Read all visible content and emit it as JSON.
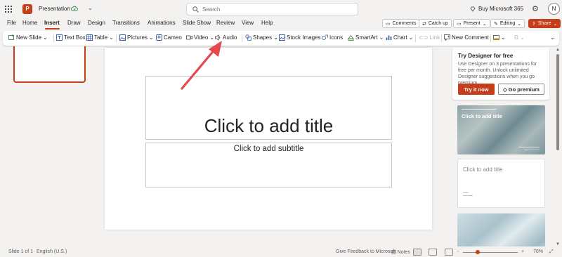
{
  "titlebar": {
    "app_logo": "P",
    "doc_title": "Presentation",
    "search_placeholder": "Search",
    "buy_label": "Buy Microsoft 365",
    "avatar_initial": "N"
  },
  "menu": {
    "tabs": [
      "File",
      "Home",
      "Insert",
      "Draw",
      "Design",
      "Transitions",
      "Animations",
      "Slide Show",
      "Review",
      "View",
      "Help"
    ],
    "active_tab": "Insert",
    "comments_label": "Comments",
    "catchup_label": "Catch up",
    "present_label": "Present",
    "editing_label": "Editing",
    "share_label": "Share"
  },
  "ribbon": {
    "new_slide": "New Slide",
    "text_box": "Text Box",
    "table": "Table",
    "pictures": "Pictures",
    "cameo": "Cameo",
    "video": "Video",
    "audio": "Audio",
    "shapes": "Shapes",
    "stock_images": "Stock Images",
    "icons": "Icons",
    "smartart": "SmartArt",
    "chart": "Chart",
    "link": "Link",
    "new_comment": "New Comment"
  },
  "slide": {
    "title_placeholder": "Click to add title",
    "subtitle_placeholder": "Click to add subtitle"
  },
  "designer": {
    "title": "Try Designer for free",
    "body": "Use Designer on 3 presentations for free per month. Unlock unlimited Designer suggestions when you go premium.",
    "try_label": "Try it now",
    "premium_label": "Go premium",
    "design1_title": "Click to add title",
    "design2_title": "Click to add title"
  },
  "status": {
    "slide_info": "Slide 1 of 1",
    "language": "English (U.S.)",
    "feedback": "Give Feedback to Microsoft",
    "notes": "Notes",
    "zoom_out": "−",
    "zoom_in": "+",
    "zoom_level": "70%"
  },
  "colors": {
    "accent": "#c43e1c",
    "arrow": "#e5484d"
  }
}
